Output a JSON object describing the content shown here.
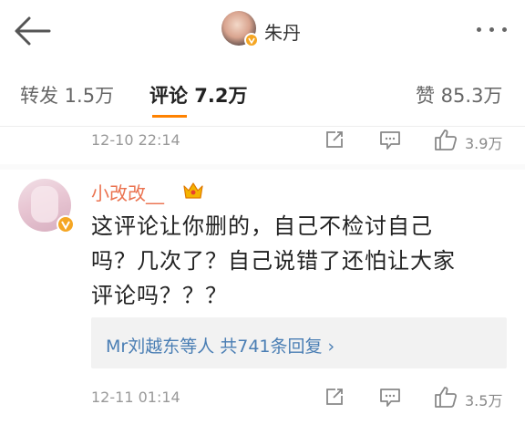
{
  "header": {
    "user_name": "朱丹"
  },
  "tabs": {
    "repost": "转发 1.5万",
    "comments": "评论 7.2万",
    "likes": "赞 85.3万"
  },
  "prev_comment": {
    "time": "12-10 22:14",
    "likes": "3.9万"
  },
  "comment": {
    "username": "小改改__",
    "lines": [
      "这评论让你删的，自己不检讨自己",
      "吗？几次了？自己说错了还怕让大家",
      "评论吗？？？"
    ],
    "reply_summary": "Mr刘越东等人 共741条回复 ›",
    "time": "12-11 01:14",
    "likes": "3.5万"
  },
  "colors": {
    "accent": "#ff8200",
    "username": "#eb7350",
    "link": "#4a7eb4",
    "verified": "#f5a623"
  }
}
